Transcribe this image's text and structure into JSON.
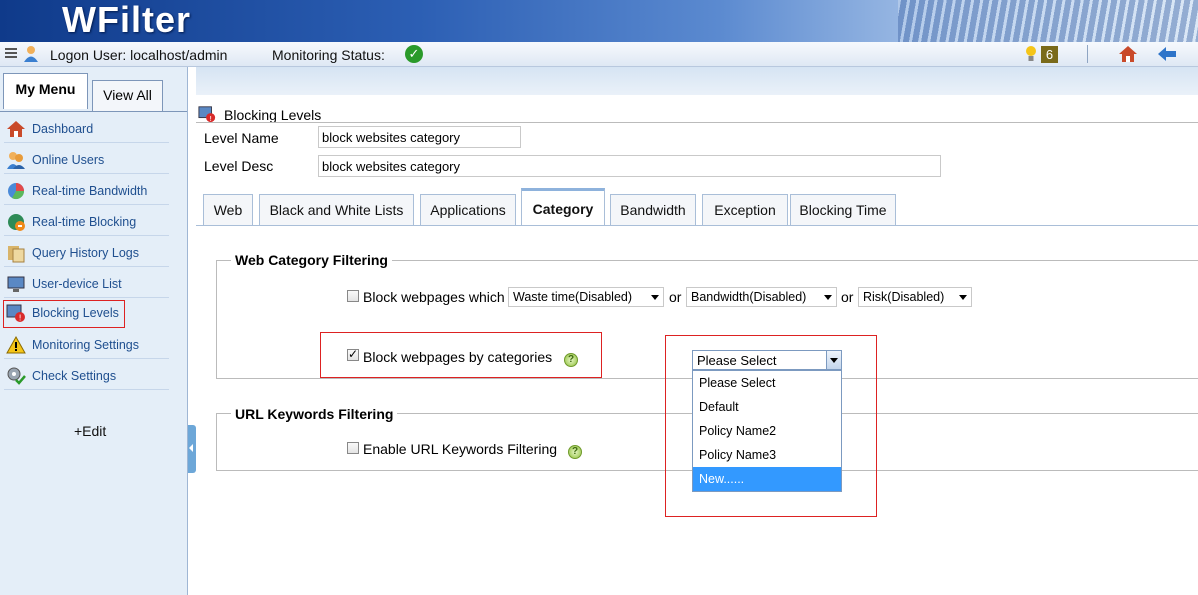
{
  "app": {
    "logo": "WFilter"
  },
  "statusbar": {
    "logon": "Logon User: localhost/admin",
    "monitoring": "Monitoring Status:",
    "notification_count": "6"
  },
  "sidebar": {
    "tabs": [
      "My Menu",
      "View All"
    ],
    "items": [
      {
        "label": "Dashboard",
        "icon": "home-icon"
      },
      {
        "label": "Online Users",
        "icon": "users-icon"
      },
      {
        "label": "Real-time Bandwidth",
        "icon": "pie-chart-icon"
      },
      {
        "label": "Real-time Blocking",
        "icon": "blocking-globe-icon"
      },
      {
        "label": "Query History Logs",
        "icon": "logs-icon"
      },
      {
        "label": "User-device List",
        "icon": "monitor-icon"
      },
      {
        "label": "Blocking Levels",
        "icon": "blocking-levels-icon"
      },
      {
        "label": "Monitoring Settings",
        "icon": "warning-icon"
      },
      {
        "label": "Check Settings",
        "icon": "gear-check-icon"
      }
    ],
    "edit": "+Edit"
  },
  "page": {
    "title": "Blocking Levels",
    "level_name_label": "Level Name",
    "level_name_value": "block websites category",
    "level_desc_label": "Level Desc",
    "level_desc_value": "block websites category"
  },
  "tabs": [
    "Web",
    "Black and White Lists",
    "Applications",
    "Category",
    "Bandwidth",
    "Exception",
    "Blocking Time"
  ],
  "active_tab": "Category",
  "web_category": {
    "title": "Web Category Filtering",
    "block_which_label": "Block webpages which",
    "select1": "Waste time(Disabled)",
    "or1": "or",
    "select2": "Bandwidth(Disabled)",
    "or2": "or",
    "select3": "Risk(Disabled)",
    "block_by_categories_label": "Block webpages by categories",
    "block_by_categories_checked": true
  },
  "url_keywords": {
    "title": "URL Keywords Filtering",
    "enable_label": "Enable URL Keywords Filtering"
  },
  "policy_dropdown": {
    "selected": "Please Select",
    "options": [
      "Please Select",
      "Default",
      "Policy Name2",
      "Policy Name3",
      "New......"
    ],
    "highlighted": "New......"
  },
  "colors": {
    "accent": "#3399ff",
    "highlight_border": "#dd2222",
    "link": "#1f4f8f"
  }
}
